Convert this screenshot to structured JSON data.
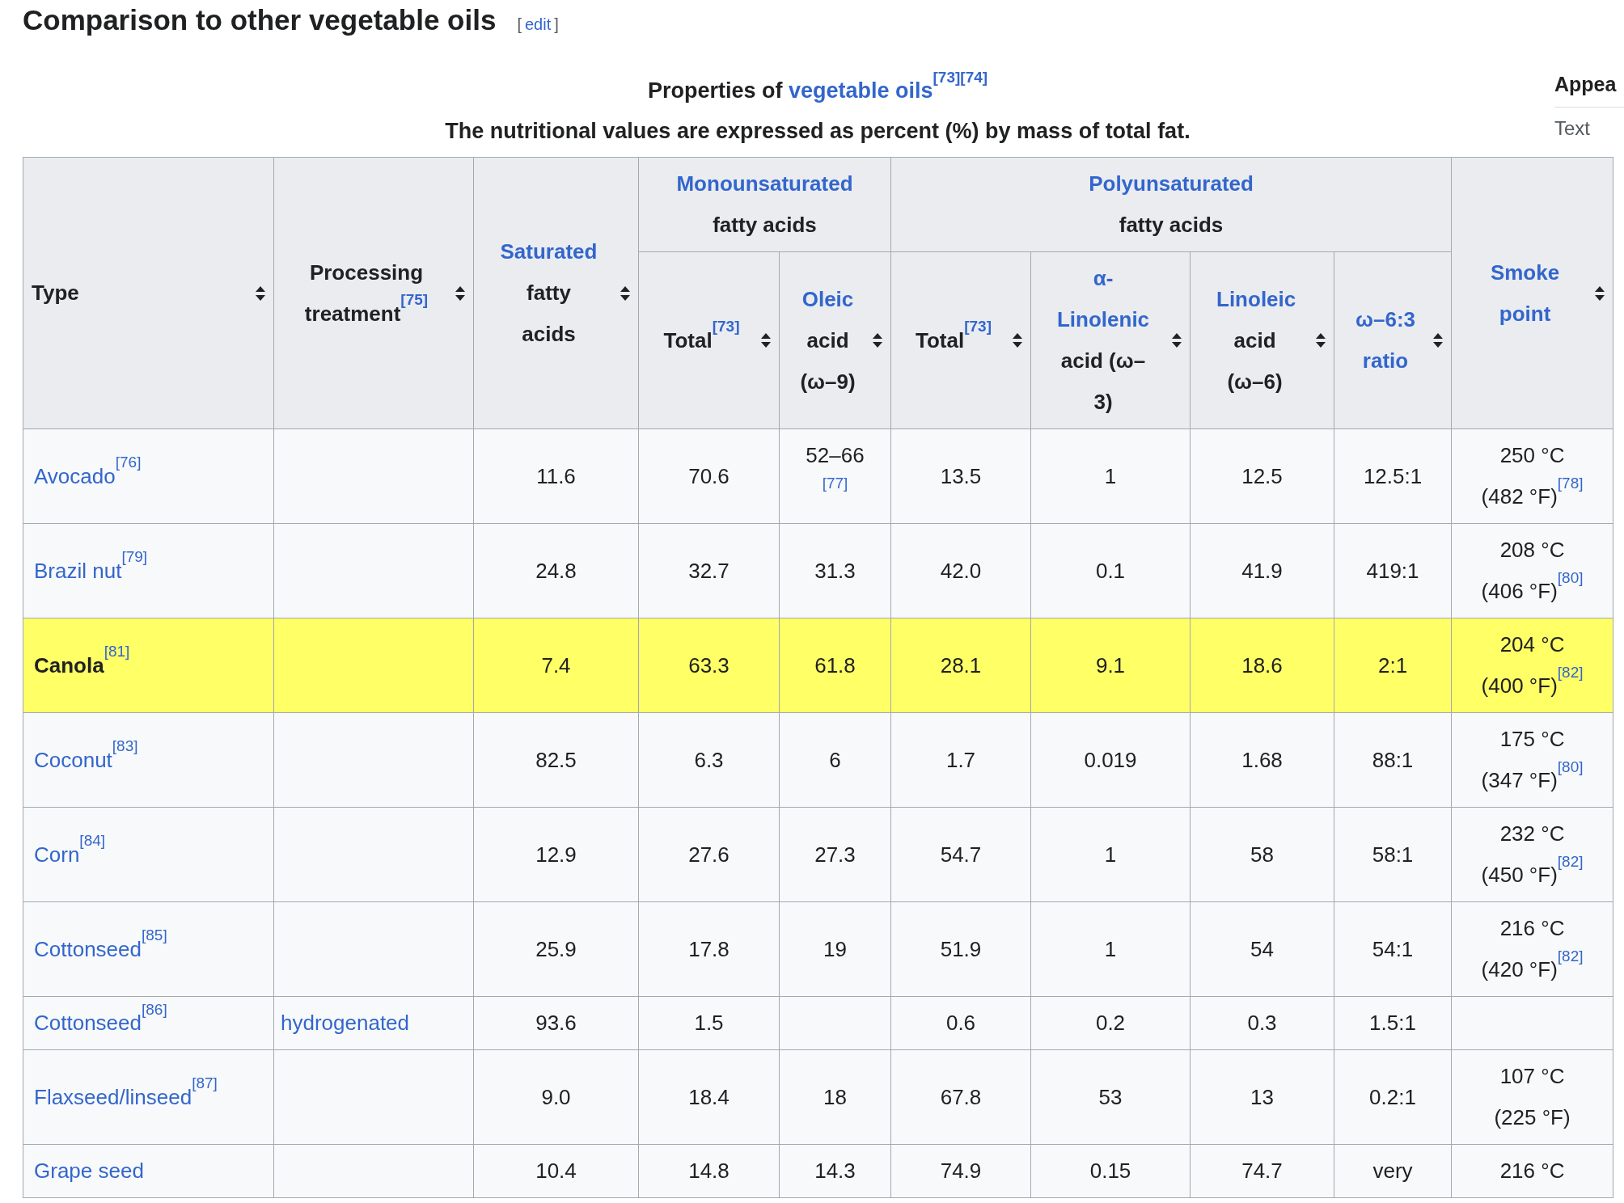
{
  "heading": {
    "title": "Comparison to other vegetable oils",
    "edit_open": "[",
    "edit": "edit",
    "edit_close": "]"
  },
  "sidebar": {
    "title": "Appea",
    "items": [
      "Text"
    ]
  },
  "caption": {
    "text": "Properties of",
    "link": "vegetable oils",
    "refs": [
      "[73]",
      "[74]"
    ],
    "note": "The nutritional values are expressed as percent (%) by mass of total fat."
  },
  "columns": [
    {
      "text": "Type",
      "sortable": true
    },
    {
      "text": "Processing treatment",
      "ref": "[75]",
      "sortable": true
    },
    {
      "link": "Saturated",
      "text": "fatty acids",
      "sortable": true
    },
    {
      "link": "Monounsaturated",
      "text": "fatty acids",
      "subcolumns": [
        {
          "text": "Total",
          "ref": "[73]",
          "sortable": true
        },
        {
          "link": "Oleic",
          "text": "acid (ω–9)",
          "sortable": true
        }
      ]
    },
    {
      "link": "Polyunsaturated",
      "text": "fatty acids",
      "subcolumns": [
        {
          "text": "Total",
          "ref": "[73]",
          "sortable": true
        },
        {
          "link": "α-Linolenic",
          "text": "acid (ω–3)",
          "sortable": true
        },
        {
          "link": "Linoleic",
          "text": "acid (ω–6)",
          "sortable": true
        },
        {
          "link": "ω–6:3 ratio",
          "sortable": true
        }
      ]
    },
    {
      "link": "Smoke point",
      "sortable": true
    }
  ],
  "rows": [
    {
      "type": {
        "text": "Avocado",
        "ref": "[76]",
        "kind": "link"
      },
      "highlighted": false,
      "cells": [
        null,
        {
          "text": "11.6"
        },
        {
          "text": "70.6"
        },
        {
          "text": "52–66",
          "ref": "[77]"
        },
        {
          "text": "13.5"
        },
        {
          "text": "1"
        },
        {
          "text": "12.5"
        },
        {
          "text": "12.5:1"
        },
        {
          "text": "250 °C (482 °F)",
          "ref": "[78]"
        }
      ]
    },
    {
      "type": {
        "text": "Brazil nut",
        "ref": "[79]",
        "kind": "link"
      },
      "highlighted": false,
      "cells": [
        null,
        {
          "text": "24.8"
        },
        {
          "text": "32.7"
        },
        {
          "text": "31.3"
        },
        {
          "text": "42.0"
        },
        {
          "text": "0.1"
        },
        {
          "text": "41.9"
        },
        {
          "text": "419:1"
        },
        {
          "text": "208 °C (406 °F)",
          "ref": "[80]"
        }
      ]
    },
    {
      "type": {
        "text": "Canola",
        "ref": "[81]",
        "kind": "self"
      },
      "highlighted": true,
      "cells": [
        null,
        {
          "text": "7.4"
        },
        {
          "text": "63.3"
        },
        {
          "text": "61.8"
        },
        {
          "text": "28.1"
        },
        {
          "text": "9.1"
        },
        {
          "text": "18.6"
        },
        {
          "text": "2:1"
        },
        {
          "text": "204 °C (400 °F)",
          "ref": "[82]"
        }
      ]
    },
    {
      "type": {
        "text": "Coconut",
        "ref": "[83]",
        "kind": "link"
      },
      "highlighted": false,
      "cells": [
        null,
        {
          "text": "82.5"
        },
        {
          "text": "6.3"
        },
        {
          "text": "6"
        },
        {
          "text": "1.7"
        },
        {
          "text": "0.019"
        },
        {
          "text": "1.68"
        },
        {
          "text": "88:1"
        },
        {
          "text": "175 °C (347 °F)",
          "ref": "[80]"
        }
      ]
    },
    {
      "type": {
        "text": "Corn",
        "ref": "[84]",
        "kind": "link"
      },
      "highlighted": false,
      "cells": [
        null,
        {
          "text": "12.9"
        },
        {
          "text": "27.6"
        },
        {
          "text": "27.3"
        },
        {
          "text": "54.7"
        },
        {
          "text": "1"
        },
        {
          "text": "58"
        },
        {
          "text": "58:1"
        },
        {
          "text": "232 °C (450 °F)",
          "ref": "[82]"
        }
      ]
    },
    {
      "type": {
        "text": "Cottonseed",
        "ref": "[85]",
        "kind": "link"
      },
      "highlighted": false,
      "cells": [
        null,
        {
          "text": "25.9"
        },
        {
          "text": "17.8"
        },
        {
          "text": "19"
        },
        {
          "text": "51.9"
        },
        {
          "text": "1"
        },
        {
          "text": "54"
        },
        {
          "text": "54:1"
        },
        {
          "text": "216 °C (420 °F)",
          "ref": "[82]"
        }
      ]
    },
    {
      "type": {
        "text": "Cottonseed",
        "ref": "[86]",
        "kind": "link"
      },
      "highlighted": false,
      "cells": [
        {
          "link": "hydrogenated"
        },
        {
          "text": "93.6"
        },
        {
          "text": "1.5"
        },
        null,
        {
          "text": "0.6"
        },
        {
          "text": "0.2"
        },
        {
          "text": "0.3"
        },
        {
          "text": "1.5:1"
        },
        null
      ]
    },
    {
      "type": {
        "text": "Flaxseed/linseed",
        "ref": "[87]",
        "kind": "link"
      },
      "highlighted": false,
      "cells": [
        null,
        {
          "text": "9.0"
        },
        {
          "text": "18.4"
        },
        {
          "text": "18"
        },
        {
          "text": "67.8"
        },
        {
          "text": "53"
        },
        {
          "text": "13"
        },
        {
          "text": "0.2:1"
        },
        {
          "text": "107 °C (225 °F)"
        }
      ]
    },
    {
      "type": {
        "text": "Grape seed",
        "kind": "link"
      },
      "highlighted": false,
      "cells": [
        null,
        {
          "text": "10.4"
        },
        {
          "text": "14.8"
        },
        {
          "text": "14.3"
        },
        {
          "text": "74.9"
        },
        {
          "text": "0.15"
        },
        {
          "text": "74.7"
        },
        {
          "text": "very"
        },
        {
          "text": "216 °C"
        }
      ]
    }
  ]
}
